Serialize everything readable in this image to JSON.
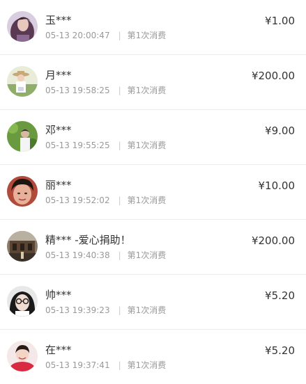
{
  "donations": [
    {
      "name": "玉***",
      "time": "05-13 20:00:47",
      "count": "第1次消费",
      "amount": "¥1.00",
      "avatar": "woman-portrait-avatar",
      "avatar_color": "#a88ab0"
    },
    {
      "name": "月***",
      "time": "05-13 19:58:25",
      "count": "第1次消费",
      "amount": "¥200.00",
      "avatar": "person-hat-avatar",
      "avatar_color": "#c8b48a"
    },
    {
      "name": "邓***",
      "time": "05-13 19:55:25",
      "count": "第1次消费",
      "amount": "¥9.00",
      "avatar": "garden-person-avatar",
      "avatar_color": "#5a8a3a"
    },
    {
      "name": "丽***",
      "time": "05-13 19:52:02",
      "count": "第1次消费",
      "amount": "¥10.00",
      "avatar": "woman-face-avatar",
      "avatar_color": "#c05a48"
    },
    {
      "name": "精*** -爱心捐助！",
      "time": "05-13 19:40:38",
      "count": "第1次消费",
      "amount": "¥200.00",
      "avatar": "building-avatar",
      "avatar_color": "#6a5440"
    },
    {
      "name": "帅***",
      "time": "05-13 19:39:23",
      "count": "第1次消费",
      "amount": "¥5.20",
      "avatar": "glasses-person-avatar",
      "avatar_color": "#2a2a2a"
    },
    {
      "name": "在***",
      "time": "05-13 19:37:41",
      "count": "第1次消费",
      "amount": "¥5.20",
      "avatar": "girl-red-avatar",
      "avatar_color": "#d03040"
    }
  ]
}
